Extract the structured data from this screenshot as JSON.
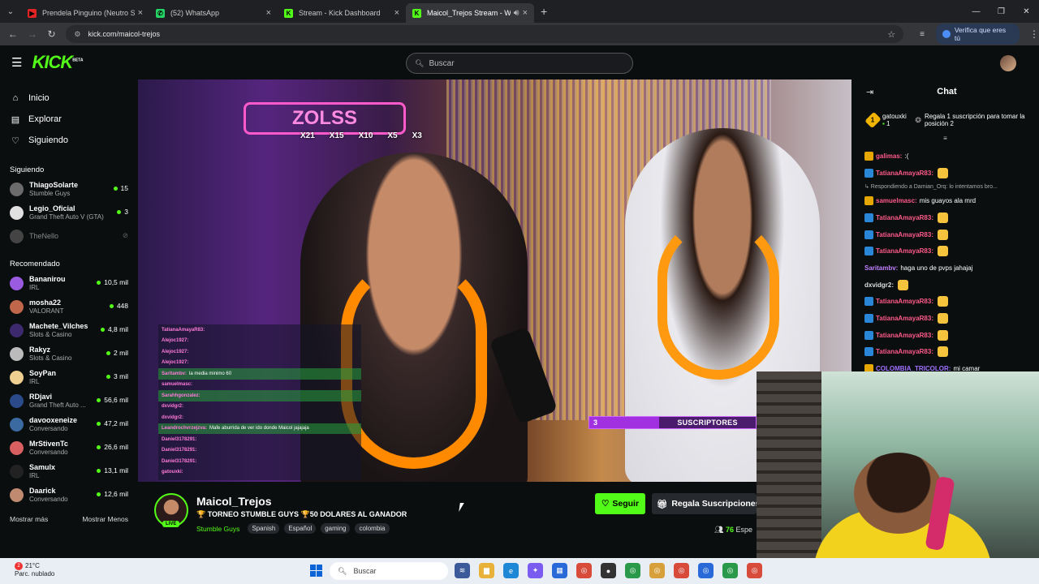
{
  "browser": {
    "tabs": [
      {
        "title": "Prendela Pinguino (Neutro Sho",
        "fav_color": "#e02424",
        "fav_glyph": "▶"
      },
      {
        "title": "(52) WhatsApp",
        "fav_color": "#25d366",
        "fav_glyph": "✆"
      },
      {
        "title": "Stream - Kick Dashboard",
        "fav_color": "#53fc18",
        "fav_glyph": "K"
      },
      {
        "title": "Maicol_Trejos Stream - Wat",
        "fav_color": "#53fc18",
        "fav_glyph": "K"
      }
    ],
    "url": "kick.com/maicol-trejos",
    "verify_label": "Verifica que eres tú"
  },
  "kick": {
    "logo": "KICK",
    "logo_badge": "BETA",
    "search_placeholder": "Buscar",
    "nav": [
      {
        "label": "Inicio",
        "icon": "⌂"
      },
      {
        "label": "Explorar",
        "icon": "▤"
      },
      {
        "label": "Siguiendo",
        "icon": "♡"
      }
    ],
    "following_title": "Siguiendo",
    "following": [
      {
        "name": "ThiagoSolarte",
        "game": "Stumble Guys",
        "viewers": "15",
        "color": "#6b6b6b"
      },
      {
        "name": "Legio_Oficial",
        "game": "Grand Theft Auto V (GTA)",
        "viewers": "3",
        "color": "#e0e0e0"
      },
      {
        "name": "TheNello",
        "game": "",
        "viewers": "",
        "color": "#444"
      }
    ],
    "recommended_title": "Recomendado",
    "recommended": [
      {
        "name": "Bananirou",
        "game": "IRL",
        "viewers": "10,5 mil",
        "color": "#9a5be0"
      },
      {
        "name": "mosha22",
        "game": "VALORANT",
        "viewers": "448",
        "color": "#c0664a"
      },
      {
        "name": "Machete_Vilches",
        "game": "Slots & Casino",
        "viewers": "4,8 mil",
        "color": "#3d2a6e"
      },
      {
        "name": "Rakyz",
        "game": "Slots & Casino",
        "viewers": "2 mil",
        "color": "#bbb"
      },
      {
        "name": "SoyPan",
        "game": "IRL",
        "viewers": "3 mil",
        "color": "#f0d090"
      },
      {
        "name": "RDjavi",
        "game": "Grand Theft Auto ...",
        "viewers": "56,6 mil",
        "color": "#2a4a8a"
      },
      {
        "name": "davooxeneize",
        "game": "Conversando",
        "viewers": "47,2 mil",
        "color": "#3a6aa0"
      },
      {
        "name": "MrStivenTc",
        "game": "Conversando",
        "viewers": "26,6 mil",
        "color": "#d86060"
      },
      {
        "name": "Samulx",
        "game": "IRL",
        "viewers": "13,1 mil",
        "color": "#222"
      },
      {
        "name": "Daarick",
        "game": "Conversando",
        "viewers": "12,6 mil",
        "color": "#c08a70"
      }
    ],
    "show_more": "Mostrar más",
    "show_less": "Mostrar Menos"
  },
  "stream": {
    "sign_text": "ZOLSS",
    "multipliers": [
      "X21",
      "X15",
      "X10",
      "X5",
      "X3"
    ],
    "overlay_chat": [
      {
        "user": "TatianaAmayaR83:",
        "text": "",
        "green": false
      },
      {
        "user": "Alejoc1927:",
        "text": "",
        "green": false
      },
      {
        "user": "Alejoc1927:",
        "text": "",
        "green": false
      },
      {
        "user": "Alejoc1927:",
        "text": "",
        "green": false
      },
      {
        "user": "Saritambv:",
        "text": "la media minimo 60",
        "green": true
      },
      {
        "user": "samuelmasc:",
        "text": "",
        "green": false
      },
      {
        "user": "Sarahhgonzalez:",
        "text": "",
        "green": true
      },
      {
        "user": "dxvidgr2:",
        "text": "",
        "green": false
      },
      {
        "user": "dxvidgr2:",
        "text": "",
        "green": false
      },
      {
        "user": "Leandrochvrzejzva:",
        "text": "Mafe aburrida de ver ido donde Maicol jajajaja",
        "green": true
      },
      {
        "user": "Daniel3178291:",
        "text": "",
        "green": false
      },
      {
        "user": "Daniel3178291:",
        "text": "",
        "green": false
      },
      {
        "user": "Daniel3178291:",
        "text": "",
        "green": false
      },
      {
        "user": "gatouxki:",
        "text": "",
        "green": false
      }
    ],
    "sub_goal_count": "3",
    "sub_goal_label": "SUSCRIPTORES",
    "sub_goal_progress": 0.42
  },
  "channel": {
    "name": "Maicol_Trejos",
    "live_label": "LIVE",
    "title": "🏆 TORNEO STUMBLE GUYS 🏆50 DOLARES AL GANADOR",
    "category": "Stumble Guys",
    "tags": [
      "Spanish",
      "Español",
      "gaming",
      "colombia"
    ],
    "follow_label": "Seguir",
    "gift_label": "Regala Suscripciones",
    "viewers_count": "76",
    "viewers_label": "Espe"
  },
  "chat": {
    "title": "Chat",
    "pinned_user": "gatouxki",
    "pinned_count": "1",
    "pinned_rank": "1",
    "pinned_text": "Regala 1 suscripción para tomar la posición 2",
    "messages": [
      {
        "user": "galimas:",
        "text": ":(",
        "color": "#ff5a8a",
        "badge": "#e6a800",
        "reply": false,
        "emote": false
      },
      {
        "user": "TatianaAmayaR83:",
        "text": "",
        "color": "#ff5a8a",
        "badge": "#2a86d6",
        "reply": false,
        "emote": true
      },
      {
        "user": "",
        "text": "↳ Respondiendo a Damian_Orq: lo intentamos bro...",
        "color": "#aaa",
        "badge": "",
        "reply": true,
        "emote": false
      },
      {
        "user": "samuelmasc:",
        "text": "mis guayos ala mrd",
        "color": "#ff5a8a",
        "badge": "#e6a800",
        "reply": false,
        "emote": false
      },
      {
        "user": "TatianaAmayaR83:",
        "text": "",
        "color": "#ff5a8a",
        "badge": "#2a86d6",
        "reply": false,
        "emote": true
      },
      {
        "user": "TatianaAmayaR83:",
        "text": "",
        "color": "#ff5a8a",
        "badge": "#2a86d6",
        "reply": false,
        "emote": true
      },
      {
        "user": "TatianaAmayaR83:",
        "text": "",
        "color": "#ff5a8a",
        "badge": "#2a86d6",
        "reply": false,
        "emote": true
      },
      {
        "user": "Saritambv:",
        "text": "haga uno de pvps jahajaj",
        "color": "#c080ff",
        "badge": "",
        "reply": false,
        "emote": false
      },
      {
        "user": "dxvidgr2:",
        "text": "",
        "color": "#ddd",
        "badge": "",
        "reply": false,
        "emote": true
      },
      {
        "user": "TatianaAmayaR83:",
        "text": "",
        "color": "#ff5a8a",
        "badge": "#2a86d6",
        "reply": false,
        "emote": true
      },
      {
        "user": "TatianaAmayaR83:",
        "text": "",
        "color": "#ff5a8a",
        "badge": "#2a86d6",
        "reply": false,
        "emote": true
      },
      {
        "user": "TatianaAmayaR83:",
        "text": "",
        "color": "#ff5a8a",
        "badge": "#2a86d6",
        "reply": false,
        "emote": true
      },
      {
        "user": "TatianaAmayaR83:",
        "text": "",
        "color": "#ff5a8a",
        "badge": "#2a86d6",
        "reply": false,
        "emote": true
      },
      {
        "user": "COLOMBIA_TRICOLOR:",
        "text": "mi camar",
        "color": "#a070ff",
        "badge": "#e6a800",
        "reply": false,
        "emote": false
      }
    ]
  },
  "taskbar": {
    "temperature": "21°C",
    "weather": "Parc. nublado",
    "notif_count": "2",
    "search_placeholder": "Buscar",
    "apps": [
      {
        "name": "news-icon",
        "color": "#3c5a9a",
        "glyph": "≋"
      },
      {
        "name": "folder-icon",
        "color": "#e8b23a",
        "glyph": "▆"
      },
      {
        "name": "edge-icon",
        "color": "#1e88d6",
        "glyph": "e"
      },
      {
        "name": "copilot-icon",
        "color": "#7a5cf0",
        "glyph": "✦"
      },
      {
        "name": "store-icon",
        "color": "#2a6ad8",
        "glyph": "▦"
      },
      {
        "name": "chrome-icon",
        "color": "#d84a3a",
        "glyph": "◎"
      },
      {
        "name": "obs-icon",
        "color": "#333",
        "glyph": "●"
      },
      {
        "name": "chrome-icon",
        "color": "#2a9a4a",
        "glyph": "◎"
      },
      {
        "name": "chrome-icon",
        "color": "#d8a03a",
        "glyph": "◎"
      },
      {
        "name": "chrome-icon",
        "color": "#d84a3a",
        "glyph": "◎"
      },
      {
        "name": "chrome-icon",
        "color": "#2a6ad8",
        "glyph": "◎"
      },
      {
        "name": "chrome-icon",
        "color": "#2a9a4a",
        "glyph": "◎"
      },
      {
        "name": "chrome-icon",
        "color": "#d84a3a",
        "glyph": "◎"
      }
    ]
  }
}
